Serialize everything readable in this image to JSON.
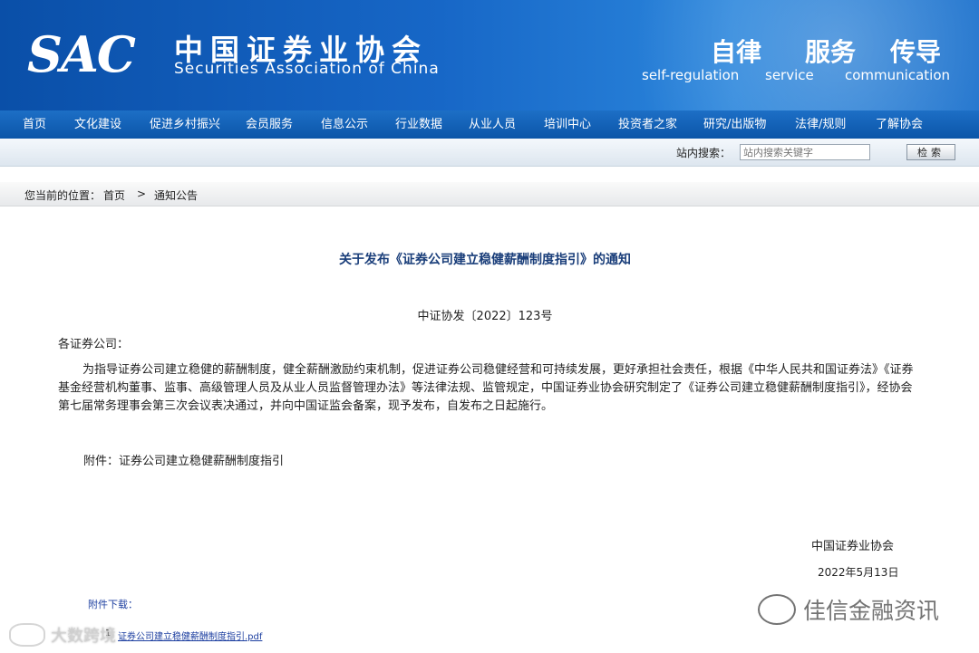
{
  "header": {
    "logo": "SAC",
    "cn_name": "中国证券业协会",
    "en_name": "Securities Association of China",
    "slogans": [
      {
        "cn": "自律",
        "en": "self-regulation"
      },
      {
        "cn": "服务",
        "en": "service"
      },
      {
        "cn": "传导",
        "en": "communication"
      }
    ]
  },
  "nav": [
    "首页",
    "文化建设",
    "促进乡村振兴",
    "会员服务",
    "信息公示",
    "行业数据",
    "从业人员",
    "培训中心",
    "投资者之家",
    "研究/出版物",
    "法律/规则",
    "了解协会"
  ],
  "search": {
    "label": "站内搜索：",
    "placeholder": "站内搜索关键字",
    "button": "检索"
  },
  "breadcrumb": {
    "prefix": "您当前的位置：",
    "home": "首页",
    "sep": ">",
    "current": "通知公告"
  },
  "article": {
    "title": "关于发布《证券公司建立稳健薪酬制度指引》的通知",
    "doc_no": "中证协发〔2022〕123号",
    "salutation": "各证券公司：",
    "body": "为指导证券公司建立稳健的薪酬制度，健全薪酬激励约束机制，促进证券公司稳健经营和可持续发展，更好承担社会责任，根据《中华人民共和国证券法》《证券基金经营机构董事、监事、高级管理人员及从业人员监督管理办法》等法律法规、监管规定，中国证券业协会研究制定了《证券公司建立稳健薪酬制度指引》，经协会第七届常务理事会第三次会议表决通过，并向中国证监会备案，现予发布，自发布之日起施行。",
    "attachment": "附件：证券公司建立稳健薪酬制度指引",
    "signature": "中国证券业协会",
    "date": "2022年5月13日"
  },
  "downloads": {
    "label": "附件下载：",
    "items": [
      {
        "num": "1",
        "name": "证券公司建立稳健薪酬制度指引.pdf"
      }
    ]
  },
  "watermarks": {
    "right": "佳信金融资讯",
    "left": "大数跨境"
  }
}
